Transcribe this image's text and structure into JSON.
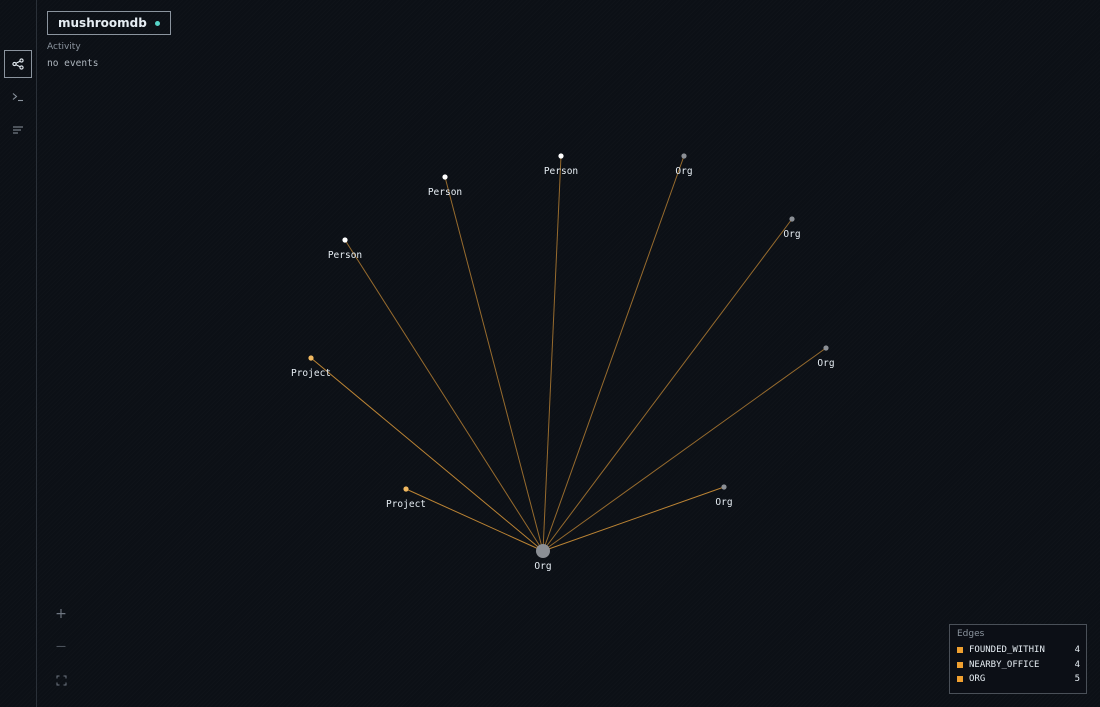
{
  "app": {
    "name": "mushroomdb",
    "status_color": "#56d4c7"
  },
  "sidebar": {
    "items": [
      {
        "name": "graph-icon",
        "active": true
      },
      {
        "name": "terminal-icon",
        "active": false
      },
      {
        "name": "list-icon",
        "active": false
      }
    ]
  },
  "activity": {
    "label": "Activity",
    "value": "no events"
  },
  "graph": {
    "edge_color": "#c58a36",
    "nodes": [
      {
        "label": "Org",
        "type": "org",
        "center": true
      },
      {
        "label": "Person",
        "type": "person"
      },
      {
        "label": "Person",
        "type": "person"
      },
      {
        "label": "Person",
        "type": "person"
      },
      {
        "label": "Org",
        "type": "org"
      },
      {
        "label": "Org",
        "type": "org"
      },
      {
        "label": "Org",
        "type": "org"
      },
      {
        "label": "Org",
        "type": "org"
      },
      {
        "label": "Project",
        "type": "project"
      },
      {
        "label": "Project",
        "type": "project"
      }
    ],
    "node_colors": {
      "org": "#8b8f95",
      "person": "#ffffff",
      "project": "#f0b860"
    }
  },
  "zoom_controls": {
    "zoom_in": "+",
    "zoom_out": "—",
    "fit": "⛶"
  },
  "legend": {
    "title": "Edges",
    "swatch_color": "#f0a030",
    "items": [
      {
        "name": "FOUNDED_WITHIN",
        "count": "4"
      },
      {
        "name": "NEARBY_OFFICE",
        "count": "4"
      },
      {
        "name": "ORG",
        "count": "5"
      }
    ]
  }
}
